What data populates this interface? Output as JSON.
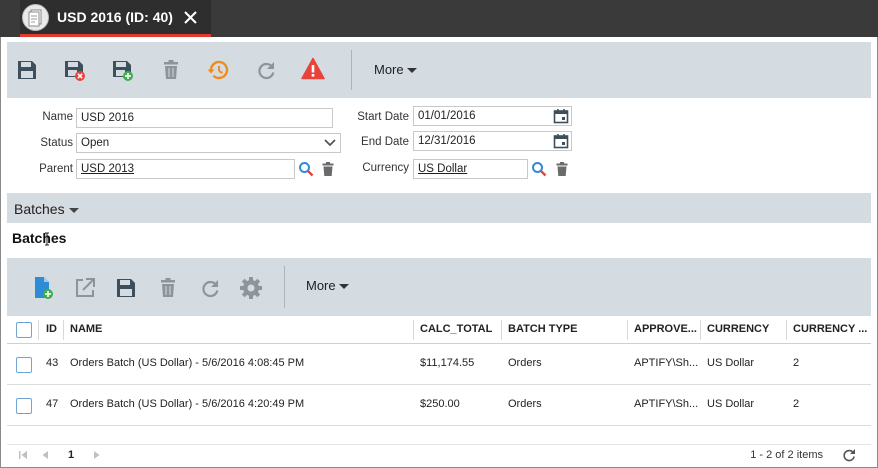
{
  "window": {
    "tab_title": "USD 2016 (ID: 40)"
  },
  "toolbar": {
    "buttons": [
      "save-icon",
      "save-and-close-icon",
      "save-and-new-icon",
      "delete-icon",
      "history-icon",
      "refresh-icon",
      "warning-icon"
    ],
    "more_label": "More"
  },
  "form": {
    "name_label": "Name",
    "name_value": "USD 2016",
    "status_label": "Status",
    "status_value": "Open",
    "parent_label": "Parent",
    "parent_value": "USD 2013",
    "start_date_label": "Start Date",
    "start_date_value": "01/01/2016",
    "end_date_label": "End Date",
    "end_date_value": "12/31/2016",
    "currency_label": "Currency",
    "currency_value": "US Dollar"
  },
  "batches": {
    "bar_label": "Batches",
    "section_title": "Batches",
    "toolbar": {
      "buttons": [
        "new-record-icon",
        "open-external-icon",
        "save-icon",
        "delete-icon",
        "refresh-icon",
        "settings-icon"
      ],
      "more_label": "More"
    },
    "columns": [
      "ID",
      "NAME",
      "CALC_TOTAL",
      "BATCH TYPE",
      "APPROVE...",
      "CURRENCY",
      "CURRENCY ..."
    ],
    "rows": [
      {
        "id": "43",
        "name": "Orders Batch (US Dollar) - 5/6/2016 4:08:45 PM",
        "calc_total": "$11,174.55",
        "batch_type": "Orders",
        "approver": "APTIFY\\Sh...",
        "currency": "US Dollar",
        "currency_id": "2"
      },
      {
        "id": "47",
        "name": "Orders Batch (US Dollar) - 5/6/2016 4:20:49 PM",
        "calc_total": "$250.00",
        "batch_type": "Orders",
        "approver": "APTIFY\\Sh...",
        "currency": "US Dollar",
        "currency_id": "2"
      }
    ],
    "pager": {
      "page": "1",
      "info": "1 - 2 of 2 items"
    }
  },
  "colors": {
    "title_bar": "#3a3a3a",
    "tab_accent": "#e23b2e",
    "toolbar_bg": "#d4dbe1",
    "icon_dark": "#3d4f5c",
    "icon_gray": "#8c959b",
    "icon_orange": "#f08c1e",
    "icon_blue": "#2e8bd6",
    "icon_red": "#e8433a",
    "icon_green": "#3db04b"
  }
}
